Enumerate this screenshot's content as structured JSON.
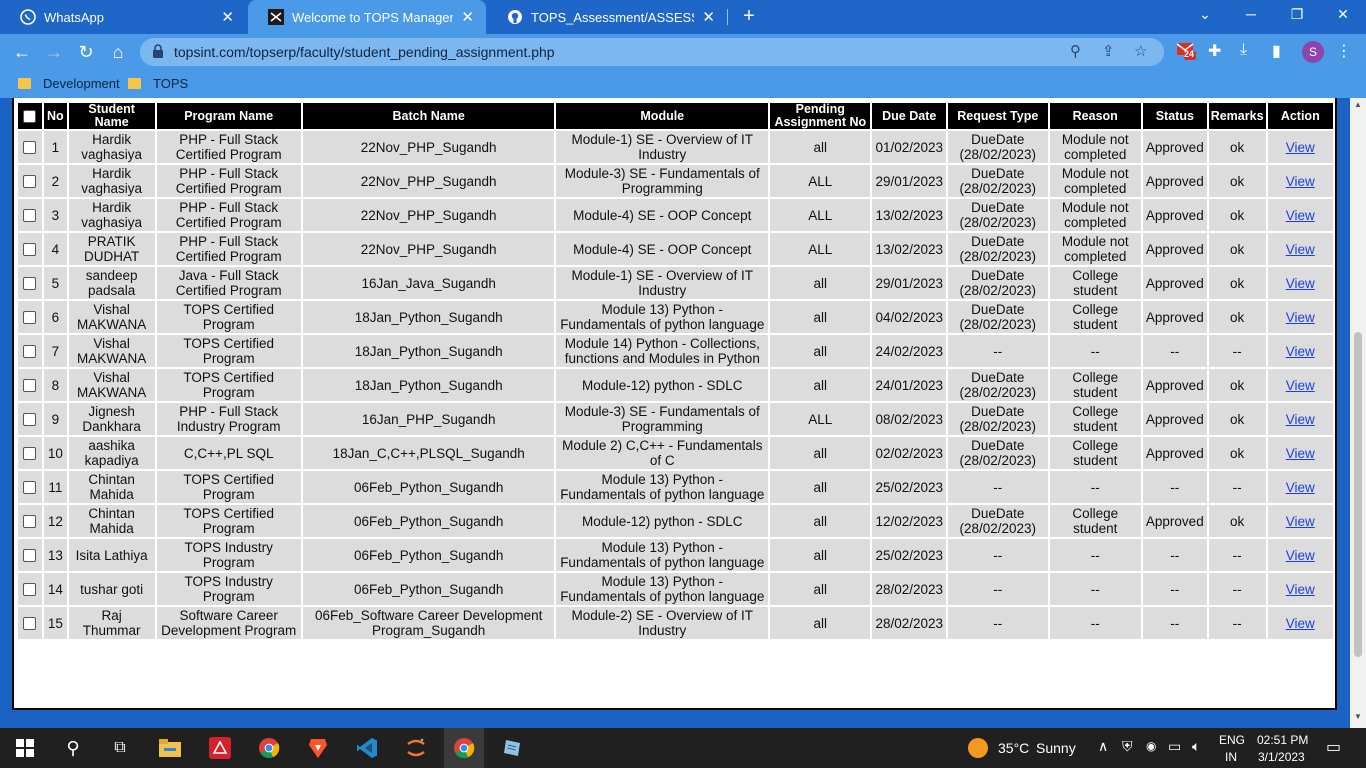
{
  "browser": {
    "tabs": [
      {
        "title": "WhatsApp",
        "close": "✕"
      },
      {
        "title": "Welcome to TOPS Management S",
        "close": "✕"
      },
      {
        "title": "TOPS_Assessment/ASSESSMENT_",
        "close": "✕"
      }
    ],
    "new_tab": "+",
    "url": "topsint.com/topserp/faculty/student_pending_assignment.php",
    "gmail_badge": "24",
    "profile_initial": "S",
    "bookmarks": [
      "Development",
      "TOPS"
    ]
  },
  "table": {
    "headers": {
      "select": "",
      "no": "No",
      "student": "Student Name",
      "program": "Program Name",
      "batch": "Batch Name",
      "module": "Module",
      "pending": "Pending Assignment No",
      "due": "Due Date",
      "request": "Request Type",
      "reason": "Reason",
      "status": "Status",
      "remarks": "Remarks",
      "action": "Action"
    },
    "rows": [
      {
        "no": "1",
        "student": "Hardik vaghasiya",
        "program": "PHP - Full Stack Certified Program",
        "batch": "22Nov_PHP_Sugandh",
        "module": "Module-1) SE - Overview of IT Industry",
        "pending": "all",
        "due": "01/02/2023",
        "request": "DueDate (28/02/2023)",
        "reason": "Module not completed",
        "status": "Approved",
        "remarks": "ok",
        "action": "View"
      },
      {
        "no": "2",
        "student": "Hardik vaghasiya",
        "program": "PHP - Full Stack Certified Program",
        "batch": "22Nov_PHP_Sugandh",
        "module": "Module-3) SE - Fundamentals of Programming",
        "pending": "ALL",
        "due": "29/01/2023",
        "request": "DueDate (28/02/2023)",
        "reason": "Module not completed",
        "status": "Approved",
        "remarks": "ok",
        "action": "View"
      },
      {
        "no": "3",
        "student": "Hardik vaghasiya",
        "program": "PHP - Full Stack Certified Program",
        "batch": "22Nov_PHP_Sugandh",
        "module": "Module-4) SE - OOP Concept",
        "pending": "ALL",
        "due": "13/02/2023",
        "request": "DueDate (28/02/2023)",
        "reason": "Module not completed",
        "status": "Approved",
        "remarks": "ok",
        "action": "View"
      },
      {
        "no": "4",
        "student": "PRATIK DUDHAT",
        "program": "PHP - Full Stack Certified Program",
        "batch": "22Nov_PHP_Sugandh",
        "module": "Module-4) SE - OOP Concept",
        "pending": "ALL",
        "due": "13/02/2023",
        "request": "DueDate (28/02/2023)",
        "reason": "Module not completed",
        "status": "Approved",
        "remarks": "ok",
        "action": "View"
      },
      {
        "no": "5",
        "student": "sandeep padsala",
        "program": "Java - Full Stack Certified Program",
        "batch": "16Jan_Java_Sugandh",
        "module": "Module-1) SE - Overview of IT Industry",
        "pending": "all",
        "due": "29/01/2023",
        "request": "DueDate (28/02/2023)",
        "reason": "College student",
        "status": "Approved",
        "remarks": "ok",
        "action": "View"
      },
      {
        "no": "6",
        "student": "Vishal MAKWANA",
        "program": "TOPS Certified Program",
        "batch": "18Jan_Python_Sugandh",
        "module": "Module 13) Python - Fundamentals of python language",
        "pending": "all",
        "due": "04/02/2023",
        "request": "DueDate (28/02/2023)",
        "reason": "College student",
        "status": "Approved",
        "remarks": "ok",
        "action": "View"
      },
      {
        "no": "7",
        "student": "Vishal MAKWANA",
        "program": "TOPS Certified Program",
        "batch": "18Jan_Python_Sugandh",
        "module": "Module 14) Python - Collections, functions and Modules in Python",
        "pending": "all",
        "due": "24/02/2023",
        "request": "--",
        "reason": "--",
        "status": "--",
        "remarks": "--",
        "action": "View"
      },
      {
        "no": "8",
        "student": "Vishal MAKWANA",
        "program": "TOPS Certified Program",
        "batch": "18Jan_Python_Sugandh",
        "module": "Module-12) python - SDLC",
        "pending": "all",
        "due": "24/01/2023",
        "request": "DueDate (28/02/2023)",
        "reason": "College student",
        "status": "Approved",
        "remarks": "ok",
        "action": "View"
      },
      {
        "no": "9",
        "student": "Jignesh Dankhara",
        "program": "PHP - Full Stack Industry Program",
        "batch": "16Jan_PHP_Sugandh",
        "module": "Module-3) SE - Fundamentals of Programming",
        "pending": "ALL",
        "due": "08/02/2023",
        "request": "DueDate (28/02/2023)",
        "reason": "College student",
        "status": "Approved",
        "remarks": "ok",
        "action": "View"
      },
      {
        "no": "10",
        "student": "aashika kapadiya",
        "program": "C,C++,PL SQL",
        "batch": "18Jan_C,C++,PLSQL_Sugandh",
        "module": "Module 2) C,C++ - Fundamentals of C",
        "pending": "all",
        "due": "02/02/2023",
        "request": "DueDate (28/02/2023)",
        "reason": "College student",
        "status": "Approved",
        "remarks": "ok",
        "action": "View"
      },
      {
        "no": "11",
        "student": "Chintan Mahida",
        "program": "TOPS Certified Program",
        "batch": "06Feb_Python_Sugandh",
        "module": "Module 13) Python - Fundamentals of python language",
        "pending": "all",
        "due": "25/02/2023",
        "request": "--",
        "reason": "--",
        "status": "--",
        "remarks": "--",
        "action": "View"
      },
      {
        "no": "12",
        "student": "Chintan Mahida",
        "program": "TOPS Certified Program",
        "batch": "06Feb_Python_Sugandh",
        "module": "Module-12) python - SDLC",
        "pending": "all",
        "due": "12/02/2023",
        "request": "DueDate (28/02/2023)",
        "reason": "College student",
        "status": "Approved",
        "remarks": "ok",
        "action": "View"
      },
      {
        "no": "13",
        "student": "Isita Lathiya",
        "program": "TOPS Industry Program",
        "batch": "06Feb_Python_Sugandh",
        "module": "Module 13) Python - Fundamentals of python language",
        "pending": "all",
        "due": "25/02/2023",
        "request": "--",
        "reason": "--",
        "status": "--",
        "remarks": "--",
        "action": "View"
      },
      {
        "no": "14",
        "student": "tushar goti",
        "program": "TOPS Industry Program",
        "batch": "06Feb_Python_Sugandh",
        "module": "Module 13) Python - Fundamentals of python language",
        "pending": "all",
        "due": "28/02/2023",
        "request": "--",
        "reason": "--",
        "status": "--",
        "remarks": "--",
        "action": "View"
      },
      {
        "no": "15",
        "student": "Raj Thummar",
        "program": "Software Career Development Program",
        "batch": "06Feb_Software Career Development Program_Sugandh",
        "module": "Module-2) SE - Overview of IT Industry",
        "pending": "all",
        "due": "28/02/2023",
        "request": "--",
        "reason": "--",
        "status": "--",
        "remarks": "--",
        "action": "View"
      }
    ]
  },
  "taskbar": {
    "weather_temp": "35°C",
    "weather_text": "Sunny",
    "language": "ENG",
    "region": "IN",
    "time": "02:51 PM",
    "date": "3/1/2023"
  },
  "colors": {
    "tabstrip": "#1f66c9",
    "toolbar": "#4a9ae8",
    "header_bg": "#000000",
    "cell_bg": "#dcdcdc",
    "link": "#1a3fdc"
  }
}
